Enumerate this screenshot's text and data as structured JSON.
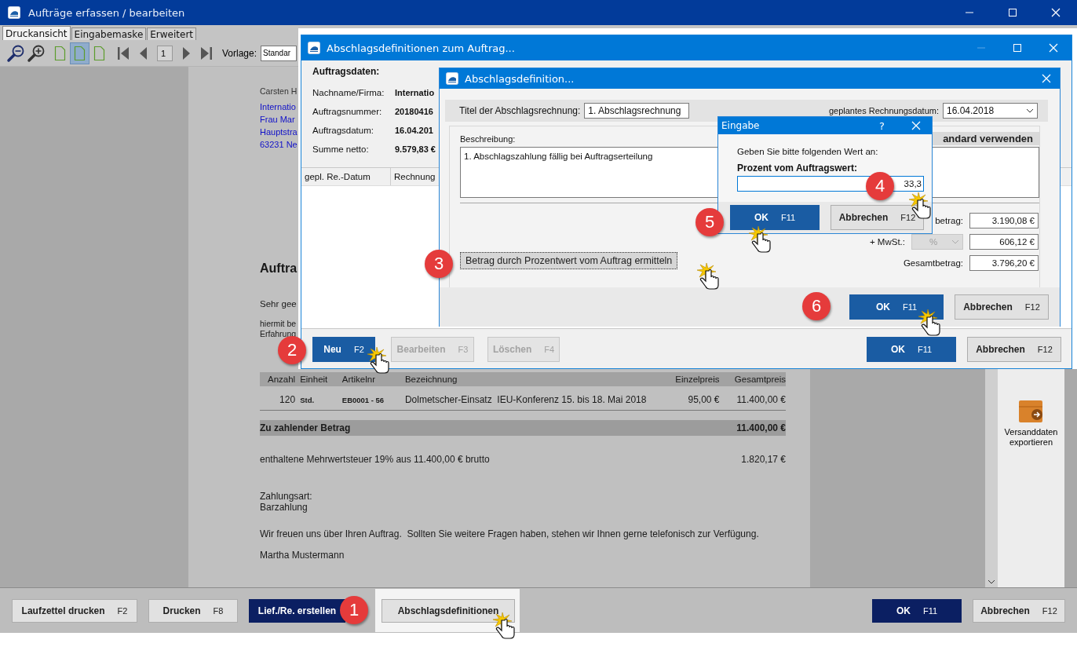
{
  "main_window": {
    "title": "Aufträge erfassen / bearbeiten",
    "tabs": [
      {
        "label": "Druckansicht",
        "selected": true
      },
      {
        "label": "Eingabemaske",
        "selected": false
      },
      {
        "label": "Erweitert",
        "selected": false
      }
    ],
    "toolbar": {
      "page_layouts": [
        {
          "selected": false
        },
        {
          "selected": true
        },
        {
          "selected": false
        }
      ],
      "page": "1",
      "template_label": "Vorlage:",
      "template_value": "Standar"
    },
    "document": {
      "sender": "Carsten H",
      "address": [
        "Internatio",
        "Frau Mar",
        "Hauptstra",
        "63231 Ne"
      ],
      "heading": "Auftra",
      "greeting": "Sehr gee",
      "intro": [
        "hiermit be",
        "Erfahrung"
      ],
      "table": {
        "columns": [
          "Anzahl",
          "Einheit",
          "Artikelnr",
          "Bezeichnung",
          "Einzelpreis",
          "Gesamtpreis"
        ],
        "rows": [
          [
            "120",
            "Std.",
            "EB0001 - 56",
            "Dolmetscher-Einsatz  IEU-Konferenz 15. bis 18. Mai 2018",
            "95,00 €",
            "11.400,00 €"
          ]
        ]
      },
      "total": {
        "label": "Zu zahlender Betrag",
        "value": "11.400,00 €"
      },
      "vat": {
        "label": "enthaltene Mehrwertsteuer 19% aus 11.400,00 € brutto",
        "value": "1.820,17 €"
      },
      "payment_label": "Zahlungsart:",
      "payment": "Barzahlung",
      "closing": "Wir freuen uns über Ihren Auftrag.  Sollten Sie weitere Fragen haben, stehen wir Ihnen gerne telefonisch zur Verfügung.",
      "signature": "Martha Mustermann"
    },
    "side_panel": {
      "label": "Versanddaten exportieren"
    },
    "buttons": [
      {
        "label": "Laufzettel drucken",
        "shortcut": "F2",
        "kind": "default",
        "highlighted": false
      },
      {
        "label": "Drucken",
        "shortcut": "F8",
        "kind": "default",
        "highlighted": false
      },
      {
        "label": "Lief./Re. erstellen",
        "kind": "dark",
        "highlighted": false
      },
      {
        "label": "Abschlagsdefinitionen",
        "kind": "default",
        "highlighted": true
      },
      {
        "label": "OK",
        "shortcut": "F11",
        "kind": "dark",
        "highlighted": false
      },
      {
        "label": "Abbrechen",
        "shortcut": "F12",
        "kind": "default",
        "highlighted": false
      }
    ]
  },
  "dialog_orders": {
    "title": "Abschlagsdefinitionen zum Auftrag...",
    "heading": "Auftragsdaten:",
    "fields": [
      {
        "label": "Nachname/Firma:",
        "value": "Internatio"
      },
      {
        "label": "Auftragsnummer:",
        "value": "20180416"
      },
      {
        "label": "Auftragsdatum:",
        "value": "16.04.201"
      },
      {
        "label": "Summe netto:",
        "value": "9.579,83 €"
      }
    ],
    "columns": [
      "gepl. Re.-Datum",
      "Rechnung"
    ],
    "buttons": [
      {
        "label": "Neu",
        "shortcut": "F2",
        "kind": "primary",
        "disabled": false
      },
      {
        "label": "Bearbeiten",
        "shortcut": "F3",
        "kind": "default",
        "disabled": true
      },
      {
        "label": "Löschen",
        "shortcut": "F4",
        "kind": "default",
        "disabled": true
      },
      {
        "label": "OK",
        "shortcut": "F11",
        "kind": "primary",
        "disabled": false
      },
      {
        "label": "Abbrechen",
        "shortcut": "F12",
        "kind": "default",
        "disabled": false
      }
    ]
  },
  "dialog_definition": {
    "title": "Abschlagsdefinition...",
    "title_label": "Titel der Abschlagsrechnung:",
    "title_value": "1. Abschlagsrechnung",
    "date_label": "geplantes Rechnungsdatum:",
    "date_value": "16.04.2018",
    "description_label": "Beschreibung:",
    "description": "1. Abschlagszahlung fällig bei Auftragserteilung",
    "standard_button": "andard verwenden",
    "percent_button": "Betrag durch Prozentwert vom Auftrag ermitteln",
    "amounts": [
      {
        "label": "betrag:",
        "value": "3.190,08 €"
      },
      {
        "label": "+ MwSt.:",
        "unit": {
          "value": "%",
          "disabled": true
        },
        "value": "606,12 €"
      },
      {
        "label": "Gesamtbetrag:",
        "value": "3.796,20 €"
      }
    ],
    "buttons": [
      {
        "label": "OK",
        "shortcut": "F11",
        "kind": "primary"
      },
      {
        "label": "Abbrechen",
        "shortcut": "F12",
        "kind": "default"
      }
    ]
  },
  "dialog_input": {
    "title": "Eingabe",
    "help": "?",
    "prompt": "Geben Sie bitte folgenden Wert an:",
    "field_label": "Prozent vom Auftragswert:",
    "value": "33,3",
    "buttons": [
      {
        "label": "OK",
        "shortcut": "F11",
        "kind": "primary"
      },
      {
        "label": "Abbrechen",
        "shortcut": "F12",
        "kind": "default"
      }
    ]
  },
  "steps": [
    "1",
    "2",
    "3",
    "4",
    "5",
    "6"
  ]
}
